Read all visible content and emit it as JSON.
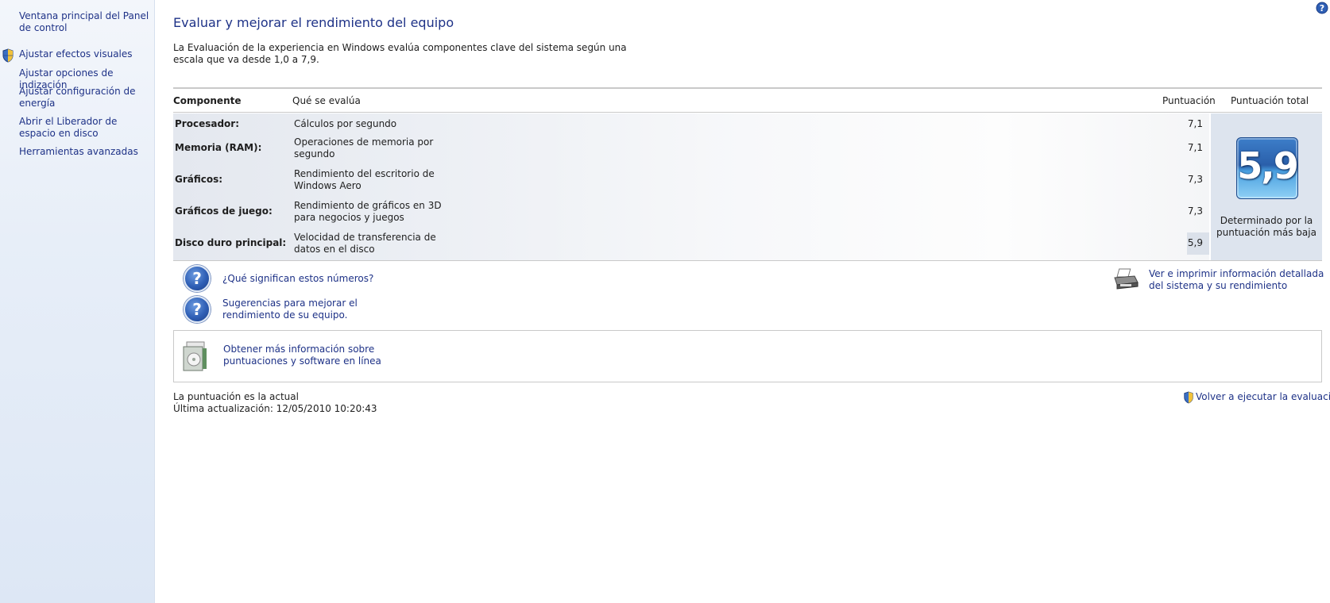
{
  "sidebar": {
    "items": [
      {
        "label": "Ventana principal del Panel de control"
      },
      {
        "label": "Ajustar efectos visuales",
        "icon": "uac-shield-icon"
      },
      {
        "label": "Ajustar opciones de indización"
      },
      {
        "label": "Ajustar configuración de energía"
      },
      {
        "label": "Abrir el Liberador de espacio en disco"
      },
      {
        "label": "Herramientas avanzadas"
      }
    ]
  },
  "main": {
    "title": "Evaluar y mejorar el rendimiento del equipo",
    "intro": "La Evaluación de la experiencia en Windows evalúa componentes clave del sistema según una escala que va desde 1,0 a 7,9.",
    "help_icon": "help-icon"
  },
  "table": {
    "headers": {
      "component": "Componente",
      "what": "Qué se evalúa",
      "score": "Puntuación",
      "total": "Puntuación total"
    },
    "rows": [
      {
        "component": "Procesador:",
        "what": "Cálculos por segundo",
        "score": "7,1"
      },
      {
        "component": "Memoria (RAM):",
        "what": "Operaciones de memoria por segundo",
        "score": "7,1"
      },
      {
        "component": "Gráficos:",
        "what": "Rendimiento del escritorio de Windows Aero",
        "score": "7,3"
      },
      {
        "component": "Gráficos de juego:",
        "what": "Rendimiento de gráficos en 3D para negocios y juegos",
        "score": "7,3"
      },
      {
        "component": "Disco duro principal:",
        "what": "Velocidad de transferencia de datos en el disco",
        "score": "5,9"
      }
    ],
    "base_score": "5,9",
    "base_caption": "Determinado por la puntuación más baja"
  },
  "links": {
    "what_numbers": "¿Qué significan estos números?",
    "tips": "Sugerencias para mejorar el rendimiento de su equipo.",
    "print_info": "Ver e imprimir información detallada del sistema y su rendimiento",
    "online_info": "Obtener más información sobre puntuaciones y software en línea"
  },
  "status": {
    "current": "La puntuación es la actual",
    "last_update": "Última actualización: 12/05/2010 10:20:43",
    "rerun": "Volver a ejecutar la evaluación"
  },
  "colors": {
    "link": "#1e3287",
    "sidebar_bg": "#e7eef8",
    "badge": "#2a5faa"
  }
}
